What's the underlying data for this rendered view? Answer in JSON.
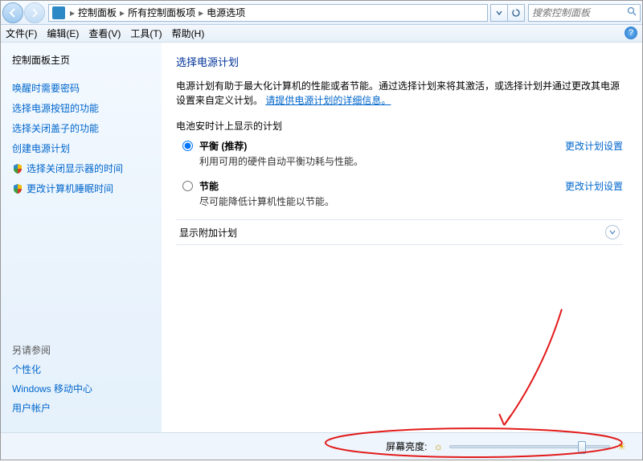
{
  "addrbar": {
    "breadcrumb": [
      "控制面板",
      "所有控制面板项",
      "电源选项"
    ],
    "search_placeholder": "搜索控制面板"
  },
  "menubar": {
    "items": [
      "文件(F)",
      "编辑(E)",
      "查看(V)",
      "工具(T)",
      "帮助(H)"
    ]
  },
  "sidebar": {
    "home": "控制面板主页",
    "links": [
      "唤醒时需要密码",
      "选择电源按钮的功能",
      "选择关闭盖子的功能",
      "创建电源计划"
    ],
    "shielded": [
      "选择关闭显示器的时间",
      "更改计算机睡眠时间"
    ],
    "seealso_title": "另请参阅",
    "seealso": [
      "个性化",
      "Windows 移动中心",
      "用户帐户"
    ]
  },
  "main": {
    "heading": "选择电源计划",
    "desc_prefix": "电源计划有助于最大化计算机的性能或者节能。通过选择计划来将其激活，或选择计划并通过更改其电源设置来自定义计划。",
    "desc_link": "请提供电源计划的详细信息。",
    "group1_title": "电池安时计上显示的计划",
    "plans": [
      {
        "name": "平衡",
        "rec": "(推荐)",
        "sub": "利用可用的硬件自动平衡功耗与性能。",
        "selected": true,
        "change": "更改计划设置"
      },
      {
        "name": "节能",
        "rec": "",
        "sub": "尽可能降低计算机性能以节能。",
        "selected": false,
        "change": "更改计划设置"
      }
    ],
    "expand_title": "显示附加计划"
  },
  "footer": {
    "brightness_label": "屏幕亮度:"
  }
}
